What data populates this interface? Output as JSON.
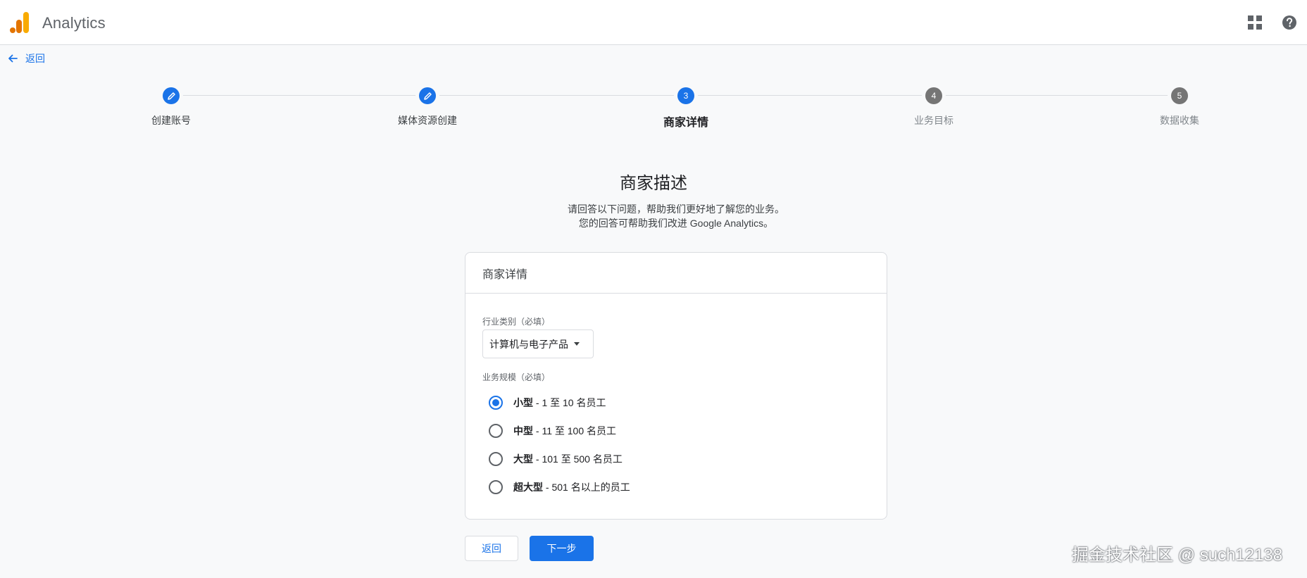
{
  "header": {
    "app_title": "Analytics",
    "logo_icon": "analytics-logo",
    "logo_colors": [
      "#E37400",
      "#F9AB00"
    ],
    "apps_icon": "apps-grid-icon",
    "help_icon": "help-icon"
  },
  "back_link": {
    "label": "返回"
  },
  "stepper": {
    "steps": [
      {
        "label": "创建账号",
        "state": "done"
      },
      {
        "label": "媒体资源创建",
        "state": "done"
      },
      {
        "label": "商家详情",
        "state": "active",
        "number": "3"
      },
      {
        "label": "业务目标",
        "state": "pending",
        "number": "4"
      },
      {
        "label": "数据收集",
        "state": "pending",
        "number": "5"
      }
    ]
  },
  "main": {
    "heading": "商家描述",
    "description_line1": "请回答以下问题，帮助我们更好地了解您的业务。",
    "description_line2": "您的回答可帮助我们改进 Google Analytics。"
  },
  "card": {
    "title": "商家详情",
    "industry": {
      "label": "行业类别（必填）",
      "selected": "计算机与电子产品"
    },
    "business_size": {
      "label": "业务规模（必填）",
      "options": [
        {
          "name": "小型",
          "desc": " - 1 至 10 名员工",
          "checked": true
        },
        {
          "name": "中型",
          "desc": " - 11 至 100 名员工",
          "checked": false
        },
        {
          "name": "大型",
          "desc": " - 101 至 500 名员工",
          "checked": false
        },
        {
          "name": "超大型",
          "desc": " - 501 名以上的员工",
          "checked": false
        }
      ]
    }
  },
  "footer": {
    "back_label": "返回",
    "next_label": "下一步"
  },
  "watermark": "掘金技术社区 @ such12138",
  "colors": {
    "accent": "#1a73e8",
    "pending": "#757575",
    "border": "#dadce0",
    "background": "#f8f9fa"
  }
}
